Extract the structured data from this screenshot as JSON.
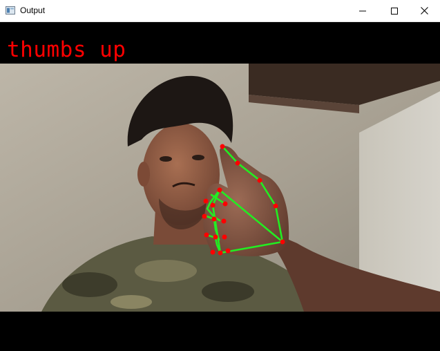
{
  "window": {
    "title": "Output"
  },
  "overlay": {
    "gesture_label": "thumbs up"
  },
  "colors": {
    "landmark": "#ff0000",
    "connection": "#22ee22",
    "label": "#ff0000"
  },
  "icons": {
    "app": "opencv-window-icon",
    "minimize": "minimize-icon",
    "maximize": "maximize-icon",
    "close": "close-icon"
  }
}
